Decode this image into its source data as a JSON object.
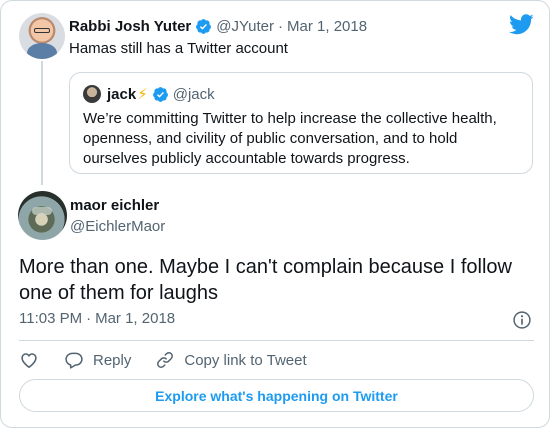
{
  "parent_tweet": {
    "author_name": "Rabbi Josh Yuter",
    "handle": "@JYuter",
    "separator": "·",
    "date": "Mar 1, 2018",
    "text": "Hamas still has a Twitter account"
  },
  "quoted_tweet": {
    "author_name": "jack",
    "emoji": "⚡",
    "handle": "@jack",
    "text": "We’re committing Twitter to help increase the collective health, openness, and civility of public conversation, and to hold ourselves publicly accountable towards progress."
  },
  "main_tweet": {
    "author_name": "maor eichler",
    "handle": "@EichlerMaor",
    "text": "More than one. Maybe I can't complain because I follow one of them for laughs",
    "time": "11:03 PM",
    "separator": "·",
    "date": "Mar 1, 2018"
  },
  "actions": {
    "reply_label": "Reply",
    "copy_link_label": "Copy link to Tweet"
  },
  "explore_label": "Explore what's happening on Twitter",
  "colors": {
    "brand_blue": "#1d9bf0",
    "border": "#cfd9de",
    "secondary_text": "#536471"
  },
  "icons": {
    "brand": "twitter-bird-icon",
    "verified": "verified-badge-icon",
    "info": "info-icon",
    "like": "heart-icon",
    "reply": "reply-bubble-icon",
    "copy_link": "link-icon"
  }
}
